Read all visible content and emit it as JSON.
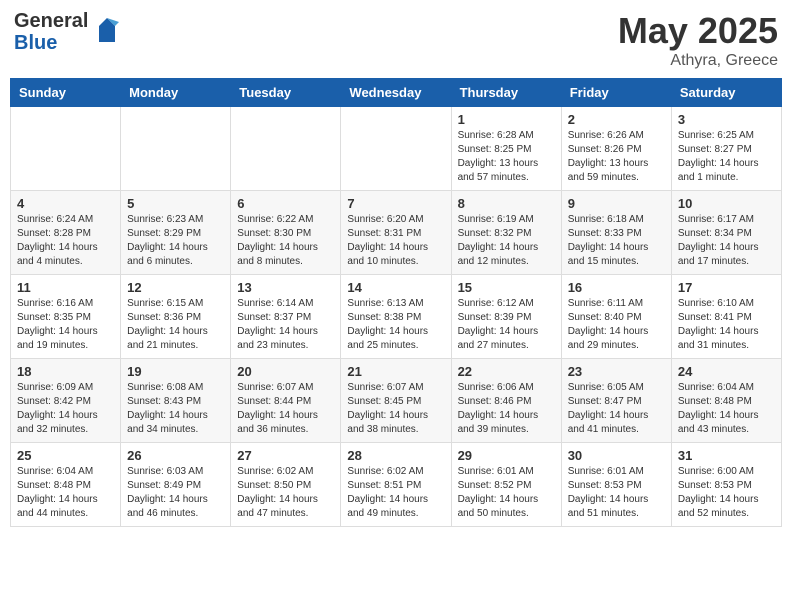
{
  "header": {
    "logo_general": "General",
    "logo_blue": "Blue",
    "title": "May 2025",
    "location": "Athyra, Greece"
  },
  "days_of_week": [
    "Sunday",
    "Monday",
    "Tuesday",
    "Wednesday",
    "Thursday",
    "Friday",
    "Saturday"
  ],
  "weeks": [
    [
      {
        "day": "",
        "info": ""
      },
      {
        "day": "",
        "info": ""
      },
      {
        "day": "",
        "info": ""
      },
      {
        "day": "",
        "info": ""
      },
      {
        "day": "1",
        "info": "Sunrise: 6:28 AM\nSunset: 8:25 PM\nDaylight: 13 hours and 57 minutes."
      },
      {
        "day": "2",
        "info": "Sunrise: 6:26 AM\nSunset: 8:26 PM\nDaylight: 13 hours and 59 minutes."
      },
      {
        "day": "3",
        "info": "Sunrise: 6:25 AM\nSunset: 8:27 PM\nDaylight: 14 hours and 1 minute."
      }
    ],
    [
      {
        "day": "4",
        "info": "Sunrise: 6:24 AM\nSunset: 8:28 PM\nDaylight: 14 hours and 4 minutes."
      },
      {
        "day": "5",
        "info": "Sunrise: 6:23 AM\nSunset: 8:29 PM\nDaylight: 14 hours and 6 minutes."
      },
      {
        "day": "6",
        "info": "Sunrise: 6:22 AM\nSunset: 8:30 PM\nDaylight: 14 hours and 8 minutes."
      },
      {
        "day": "7",
        "info": "Sunrise: 6:20 AM\nSunset: 8:31 PM\nDaylight: 14 hours and 10 minutes."
      },
      {
        "day": "8",
        "info": "Sunrise: 6:19 AM\nSunset: 8:32 PM\nDaylight: 14 hours and 12 minutes."
      },
      {
        "day": "9",
        "info": "Sunrise: 6:18 AM\nSunset: 8:33 PM\nDaylight: 14 hours and 15 minutes."
      },
      {
        "day": "10",
        "info": "Sunrise: 6:17 AM\nSunset: 8:34 PM\nDaylight: 14 hours and 17 minutes."
      }
    ],
    [
      {
        "day": "11",
        "info": "Sunrise: 6:16 AM\nSunset: 8:35 PM\nDaylight: 14 hours and 19 minutes."
      },
      {
        "day": "12",
        "info": "Sunrise: 6:15 AM\nSunset: 8:36 PM\nDaylight: 14 hours and 21 minutes."
      },
      {
        "day": "13",
        "info": "Sunrise: 6:14 AM\nSunset: 8:37 PM\nDaylight: 14 hours and 23 minutes."
      },
      {
        "day": "14",
        "info": "Sunrise: 6:13 AM\nSunset: 8:38 PM\nDaylight: 14 hours and 25 minutes."
      },
      {
        "day": "15",
        "info": "Sunrise: 6:12 AM\nSunset: 8:39 PM\nDaylight: 14 hours and 27 minutes."
      },
      {
        "day": "16",
        "info": "Sunrise: 6:11 AM\nSunset: 8:40 PM\nDaylight: 14 hours and 29 minutes."
      },
      {
        "day": "17",
        "info": "Sunrise: 6:10 AM\nSunset: 8:41 PM\nDaylight: 14 hours and 31 minutes."
      }
    ],
    [
      {
        "day": "18",
        "info": "Sunrise: 6:09 AM\nSunset: 8:42 PM\nDaylight: 14 hours and 32 minutes."
      },
      {
        "day": "19",
        "info": "Sunrise: 6:08 AM\nSunset: 8:43 PM\nDaylight: 14 hours and 34 minutes."
      },
      {
        "day": "20",
        "info": "Sunrise: 6:07 AM\nSunset: 8:44 PM\nDaylight: 14 hours and 36 minutes."
      },
      {
        "day": "21",
        "info": "Sunrise: 6:07 AM\nSunset: 8:45 PM\nDaylight: 14 hours and 38 minutes."
      },
      {
        "day": "22",
        "info": "Sunrise: 6:06 AM\nSunset: 8:46 PM\nDaylight: 14 hours and 39 minutes."
      },
      {
        "day": "23",
        "info": "Sunrise: 6:05 AM\nSunset: 8:47 PM\nDaylight: 14 hours and 41 minutes."
      },
      {
        "day": "24",
        "info": "Sunrise: 6:04 AM\nSunset: 8:48 PM\nDaylight: 14 hours and 43 minutes."
      }
    ],
    [
      {
        "day": "25",
        "info": "Sunrise: 6:04 AM\nSunset: 8:48 PM\nDaylight: 14 hours and 44 minutes."
      },
      {
        "day": "26",
        "info": "Sunrise: 6:03 AM\nSunset: 8:49 PM\nDaylight: 14 hours and 46 minutes."
      },
      {
        "day": "27",
        "info": "Sunrise: 6:02 AM\nSunset: 8:50 PM\nDaylight: 14 hours and 47 minutes."
      },
      {
        "day": "28",
        "info": "Sunrise: 6:02 AM\nSunset: 8:51 PM\nDaylight: 14 hours and 49 minutes."
      },
      {
        "day": "29",
        "info": "Sunrise: 6:01 AM\nSunset: 8:52 PM\nDaylight: 14 hours and 50 minutes."
      },
      {
        "day": "30",
        "info": "Sunrise: 6:01 AM\nSunset: 8:53 PM\nDaylight: 14 hours and 51 minutes."
      },
      {
        "day": "31",
        "info": "Sunrise: 6:00 AM\nSunset: 8:53 PM\nDaylight: 14 hours and 52 minutes."
      }
    ]
  ]
}
